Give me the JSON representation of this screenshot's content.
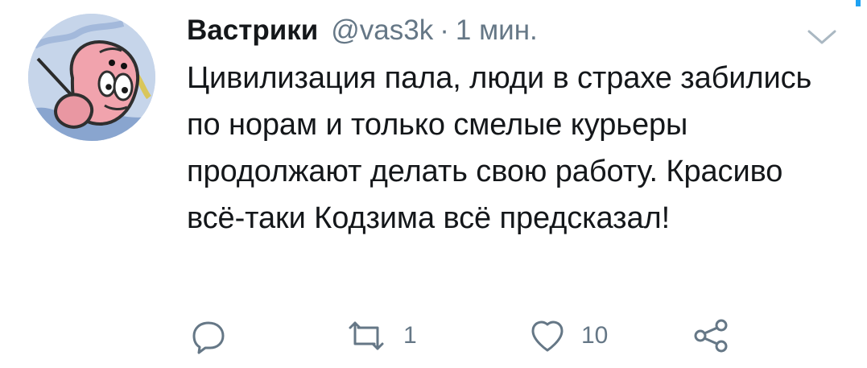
{
  "tweet": {
    "display_name": "Вастрики",
    "handle": "@vas3k",
    "separator": "·",
    "time": "1 мин.",
    "text": "Цивилизация пала, люди в страхе забились по норам и только смелые курьеры продолжают делать свою работу. Красиво всё-таки Кодзима всё предсказал!"
  },
  "actions": {
    "reply": {
      "icon": "reply-icon"
    },
    "retweet": {
      "icon": "retweet-icon",
      "count": "1"
    },
    "like": {
      "icon": "heart-icon",
      "count": "10"
    },
    "share": {
      "icon": "share-icon"
    }
  },
  "menu": {
    "icon": "chevron-down-icon"
  },
  "colors": {
    "text": "#14171a",
    "secondary_text": "#657786",
    "accent": "#1da1f2"
  }
}
